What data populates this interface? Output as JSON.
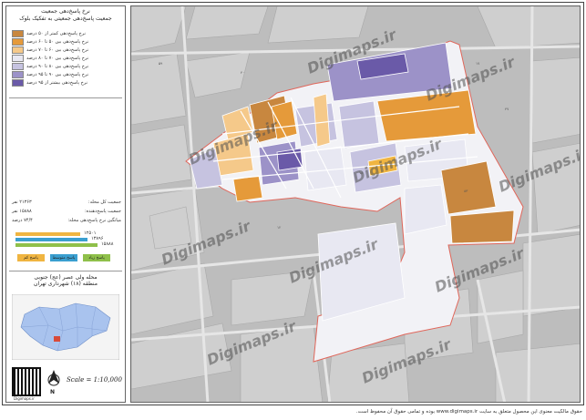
{
  "legend": {
    "title_line1": "نرخ پاسخ‌دهی جمعیت",
    "title_line2": "جمعیت پاسخ‌دهی جمعیتی به تفکیک بلوک",
    "classes": [
      {
        "label": "نرخ پاسخ‌دهی کمتر از ۵۰ درصد",
        "color": "#c8873f"
      },
      {
        "label": "نرخ پاسخ‌دهی بین ۵۰ تا ۶۰ درصد",
        "color": "#e59a3a"
      },
      {
        "label": "نرخ پاسخ‌دهی بین ۶۰ تا ۷۰ درصد",
        "color": "#f5c98a"
      },
      {
        "label": "نرخ پاسخ‌دهی بین ۷۰ تا ۸۰ درصد",
        "color": "#e8e8f2"
      },
      {
        "label": "نرخ پاسخ‌دهی بین ۸۰ تا ۹۰ درصد",
        "color": "#c6c3e0"
      },
      {
        "label": "نرخ پاسخ‌دهی بین ۹۰ تا ۹۵ درصد",
        "color": "#9c92c8"
      },
      {
        "label": "نرخ پاسخ‌دهی بیشتر از ۹۵ درصد",
        "color": "#6a5aa8"
      }
    ],
    "stats": [
      {
        "label": "جمعیت کل محله:",
        "value": "۲۱۳۶۳ نفر"
      },
      {
        "label": "جمعیت پاسخ‌دهنده:",
        "value": "۱۵۸۸۸ نفر"
      },
      {
        "label": "میانگین نرخ پاسخ‌دهی محله:",
        "value": "۷۴/۴ درصد"
      }
    ],
    "bars": [
      {
        "label": "۱۲۵۰۱",
        "fraction": 0.58,
        "color": "#f0b541"
      },
      {
        "label": "۱۳۸۹۶",
        "fraction": 0.65,
        "color": "#3a9fd0"
      },
      {
        "label": "۱۵۸۸۸",
        "fraction": 0.74,
        "color": "#8fc04a"
      }
    ],
    "chips": [
      {
        "label": "پاسخ کم",
        "color": "#f0b541"
      },
      {
        "label": "پاسخ متوسط",
        "color": "#3a9fd0"
      },
      {
        "label": "پاسخ زیاد",
        "color": "#8fc04a"
      }
    ],
    "place_line1": "محله ولی عصر (عج) جنوبی",
    "place_line2": "منطقه (۱۸) شهرداری تهران",
    "scale_text": "Scale = 1:10,000",
    "north_label": "N",
    "qr_caption": "Digimaps.ir"
  },
  "map": {
    "watermark": "Digimaps.ir",
    "labels": [
      "۱۷",
      "۱۸",
      "۵۹",
      "۸۳",
      "۱۲",
      "۴۷",
      "۴۰"
    ]
  },
  "footer": "حقوق مالکیت معنوی این محصول متعلق به سایت www.digimaps.ir بوده و تمامی حقوق آن محفوظ است."
}
